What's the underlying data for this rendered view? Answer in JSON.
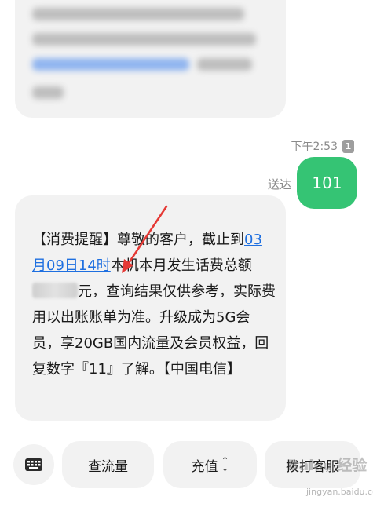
{
  "outgoing": {
    "time": "下午2:53",
    "sim_badge": "1",
    "status": "送达",
    "message": "101"
  },
  "incoming": {
    "part1": "【消费提醒】尊敬的客户，截止到",
    "link_text": "03月09日14时",
    "part2": "本机本月发生话费总额",
    "part3": "元，查询结果仅供参考，实际费用以出账账单为准。升级成为5G会员，享20GB国内流量及会员权益，回复数字『11』了解。【中国电信】"
  },
  "quick_replies": {
    "keyboard_icon": "keyboard-icon",
    "btn1": "查流量",
    "btn2": "充值",
    "btn3": "拨打客服"
  },
  "watermark": {
    "url": "jingyan.baidu.com"
  },
  "colors": {
    "outgoing_bubble": "#35c474",
    "incoming_bubble": "#f2f2f2",
    "link": "#1e6fe0",
    "annotation_arrow": "#e53935"
  }
}
